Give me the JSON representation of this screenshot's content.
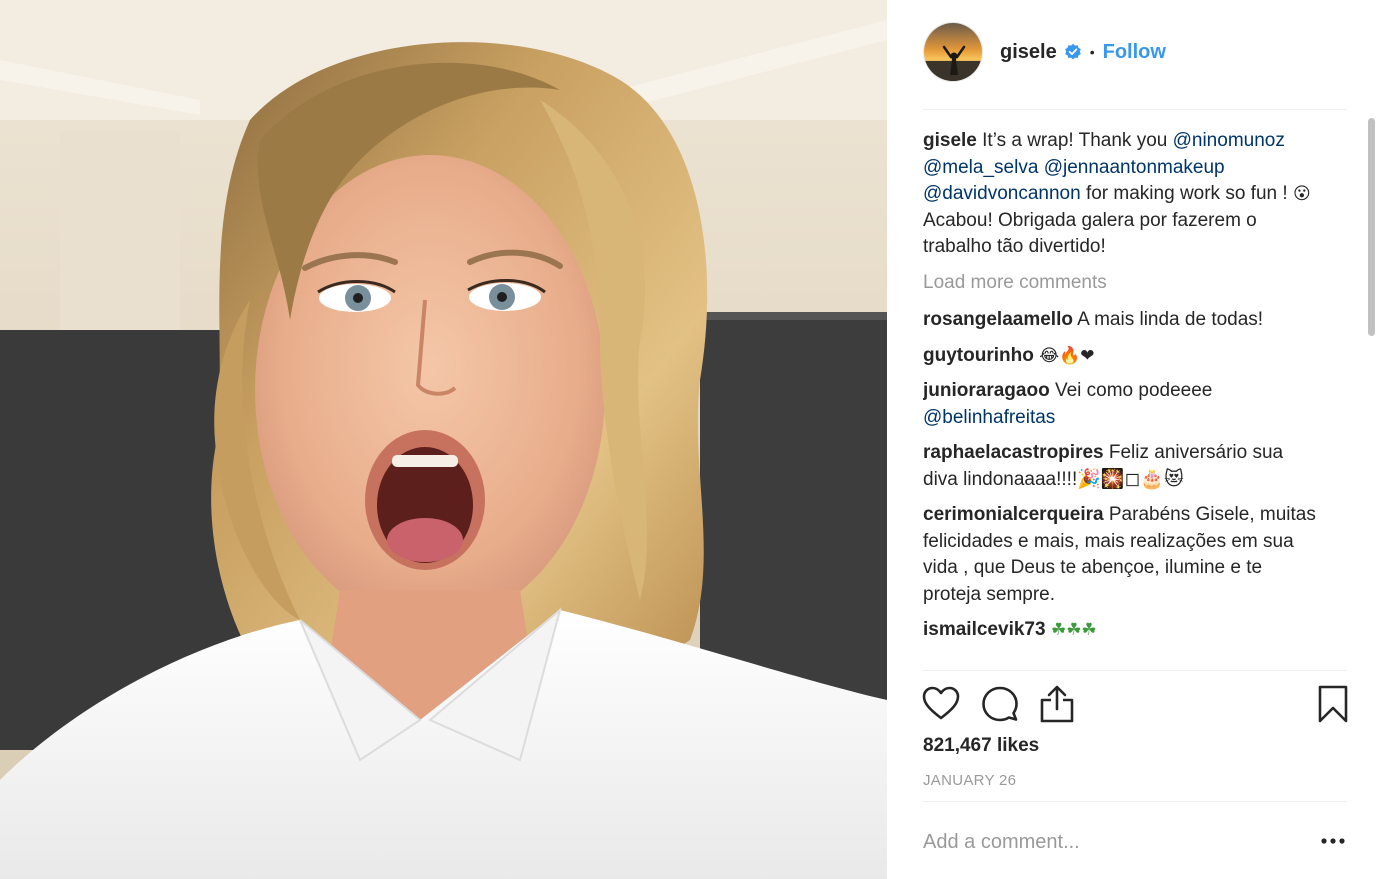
{
  "post": {
    "username": "gisele",
    "follow_label": "Follow",
    "separator": "•",
    "photo_description_icon": "selfie-photo",
    "likes": "821,467 likes",
    "date": "JANUARY 26"
  },
  "caption": {
    "username": "gisele",
    "text_1": " It’s a wrap! Thank you ",
    "mention_1": "@ninomunoz",
    "space_1": " ",
    "mention_2": "@mela_selva",
    "space_2": " ",
    "mention_3": "@jennaantonmakeup",
    "space_3": " ",
    "mention_4": "@davidvoncannon",
    "text_2": " for making work so fun ! ",
    "emoji_1": "😮",
    "text_3": " Acabou! Obrigada galera por fazerem o trabalho tão divertido!"
  },
  "load_more": "Load more comments",
  "comments": [
    {
      "username": "rosangelaamello",
      "text": " A mais linda de todas!"
    },
    {
      "username": "guytourinho",
      "text": " 😂🔥❤"
    },
    {
      "username": "junioraragaoo",
      "text": " Vei como podeeee ",
      "mention": "@belinhafreitas"
    },
    {
      "username": "raphaelacastropires",
      "text": " Feliz aniversário sua diva lindonaaaa!!!!🎉🎇◻🎂😻"
    },
    {
      "username": "cerimonialcerqueira",
      "text": " Parabéns Gisele, muitas felicidades e mais, mais realizações em sua vida , que Deus te abençoe, ilumine e te proteja sempre."
    },
    {
      "username": "ismailcevik73",
      "text": " ☘☘☘"
    }
  ],
  "actions": {
    "like_icon": "heart-icon",
    "comment_icon": "comment-bubble-icon",
    "share_icon": "share-icon",
    "save_icon": "bookmark-icon"
  },
  "add_comment": {
    "placeholder": "Add a comment..."
  },
  "colors": {
    "link_blue": "#3897f0",
    "mention_navy": "#003569",
    "muted_gray": "#999999",
    "text_dark": "#262626"
  }
}
